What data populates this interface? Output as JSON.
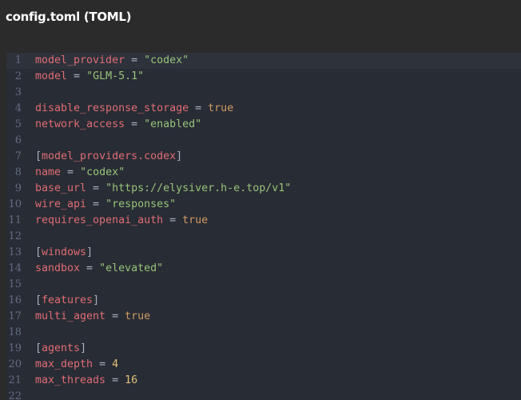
{
  "window": {
    "title": "config.toml (TOML)"
  },
  "colors": {
    "key": "#e06c75",
    "string": "#98c379",
    "boolean": "#d19a66",
    "number": "#e5c07b",
    "operator": "#abb2bf",
    "gutter": "#636d83",
    "editor_bg": "#282c34",
    "header_bg": "#2b2b2b"
  },
  "editor": {
    "active_line": 1,
    "lines": [
      {
        "n": "1",
        "tokens": [
          [
            "key",
            "model_provider"
          ],
          [
            "op",
            " = "
          ],
          [
            "str",
            "\"codex\""
          ]
        ]
      },
      {
        "n": "2",
        "tokens": [
          [
            "key",
            "model"
          ],
          [
            "op",
            " = "
          ],
          [
            "str",
            "\"GLM-5.1\""
          ]
        ]
      },
      {
        "n": "3",
        "tokens": []
      },
      {
        "n": "4",
        "tokens": [
          [
            "key",
            "disable_response_storage"
          ],
          [
            "op",
            " = "
          ],
          [
            "bool",
            "true"
          ]
        ]
      },
      {
        "n": "5",
        "tokens": [
          [
            "key",
            "network_access"
          ],
          [
            "op",
            " = "
          ],
          [
            "str",
            "\"enabled\""
          ]
        ]
      },
      {
        "n": "6",
        "tokens": []
      },
      {
        "n": "7",
        "tokens": [
          [
            "br",
            "["
          ],
          [
            "key",
            "model_providers.codex"
          ],
          [
            "br",
            "]"
          ]
        ]
      },
      {
        "n": "8",
        "tokens": [
          [
            "key",
            "name"
          ],
          [
            "op",
            " = "
          ],
          [
            "str",
            "\"codex\""
          ]
        ]
      },
      {
        "n": "9",
        "tokens": [
          [
            "key",
            "base_url"
          ],
          [
            "op",
            " = "
          ],
          [
            "str",
            "\"https://elysiver.h-e.top/v1\""
          ]
        ]
      },
      {
        "n": "10",
        "tokens": [
          [
            "key",
            "wire_api"
          ],
          [
            "op",
            " = "
          ],
          [
            "str",
            "\"responses\""
          ]
        ]
      },
      {
        "n": "11",
        "tokens": [
          [
            "key",
            "requires_openai_auth"
          ],
          [
            "op",
            " = "
          ],
          [
            "bool",
            "true"
          ]
        ]
      },
      {
        "n": "12",
        "tokens": []
      },
      {
        "n": "13",
        "tokens": [
          [
            "br",
            "["
          ],
          [
            "key",
            "windows"
          ],
          [
            "br",
            "]"
          ]
        ]
      },
      {
        "n": "14",
        "tokens": [
          [
            "key",
            "sandbox"
          ],
          [
            "op",
            " = "
          ],
          [
            "str",
            "\"elevated\""
          ]
        ]
      },
      {
        "n": "15",
        "tokens": []
      },
      {
        "n": "16",
        "tokens": [
          [
            "br",
            "["
          ],
          [
            "key",
            "features"
          ],
          [
            "br",
            "]"
          ]
        ]
      },
      {
        "n": "17",
        "tokens": [
          [
            "key",
            "multi_agent"
          ],
          [
            "op",
            " = "
          ],
          [
            "bool",
            "true"
          ]
        ]
      },
      {
        "n": "18",
        "tokens": []
      },
      {
        "n": "19",
        "tokens": [
          [
            "br",
            "["
          ],
          [
            "key",
            "agents"
          ],
          [
            "br",
            "]"
          ]
        ]
      },
      {
        "n": "20",
        "tokens": [
          [
            "key",
            "max_depth"
          ],
          [
            "op",
            " = "
          ],
          [
            "num",
            "4"
          ]
        ]
      },
      {
        "n": "21",
        "tokens": [
          [
            "key",
            "max_threads"
          ],
          [
            "op",
            " = "
          ],
          [
            "num",
            "16"
          ]
        ]
      },
      {
        "n": "22",
        "tokens": []
      }
    ]
  }
}
